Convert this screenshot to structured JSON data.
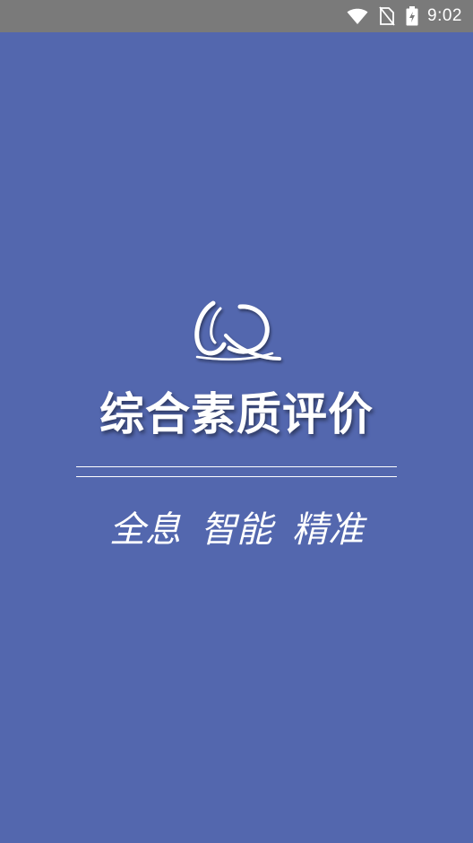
{
  "status_bar": {
    "time": "9:02",
    "icons": [
      "wifi-icon",
      "no-sim-icon",
      "battery-charging-icon"
    ]
  },
  "splash": {
    "title": "综合素质评价",
    "slogan": [
      "全息",
      "智能",
      "精准"
    ]
  },
  "colors": {
    "background": "#5367ae",
    "status_bar": "#7a7a7a",
    "text": "#ffffff"
  }
}
